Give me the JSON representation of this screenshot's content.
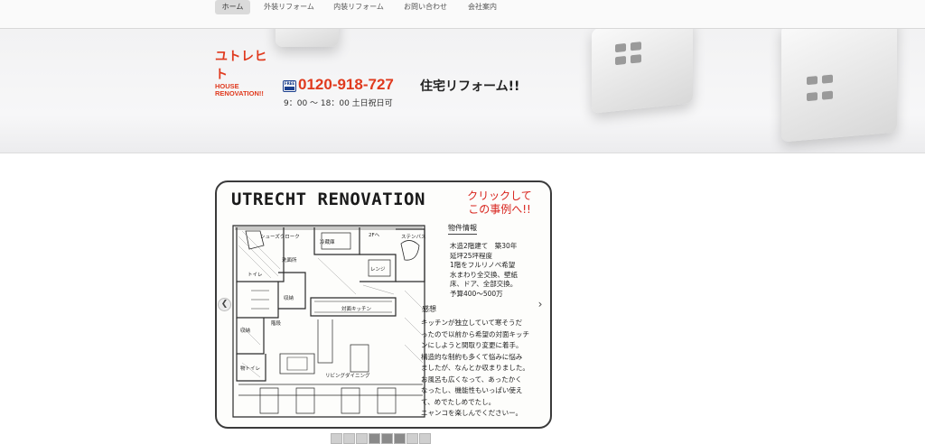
{
  "nav": {
    "items": [
      {
        "label": "ホーム",
        "active": true
      },
      {
        "label": "外装リフォーム",
        "active": false
      },
      {
        "label": "内装リフォーム",
        "active": false
      },
      {
        "label": "お問い合わせ",
        "active": false
      },
      {
        "label": "会社案内",
        "active": false
      }
    ]
  },
  "header": {
    "brand_name": "ユトレヒト",
    "brand_sub_1": "HOUSE",
    "brand_sub_2": "RENOVATION!!",
    "freedial_icon": "free-dial-icon",
    "freedial_text": "FREE",
    "phone": "0120-918-727",
    "hours": "9：00 〜 18：00 土日祝日可",
    "tagline": "住宅リフォーム!!",
    "accent_color": "#e03a1e",
    "freedial_color": "#1b3f8e"
  },
  "slider": {
    "title": "UTRECHT RENOVATION",
    "click_note_1": "クリックして",
    "click_note_2": "この事例へ!!",
    "room_labels": [
      "シューズクローク",
      "洗面所",
      "トイレ",
      "収納",
      "2Fへ",
      "冷蔵庫",
      "レンジ",
      "ステンバス",
      "対面キッチン",
      "収納",
      "階段",
      "物トイレ",
      "リビングダイニング"
    ],
    "info_heading": "物件情報",
    "info_lines": [
      "木造2階建て　築30年",
      "延坪25坪程度",
      "1階をフルリノベ希望",
      "水まわり全交換、壁紙",
      "床、ドア、全部交換。",
      "予算400〜500万"
    ],
    "impressions_heading": "感想",
    "impressions_lines": [
      "キッチンが独立していて寒そうだ",
      "ったので以前から希望の対面キッチ",
      "ンにしようと間取り変更に着手。",
      "構造的な制約も多くて悩みに悩み",
      "ましたが、なんとか収まりました。",
      "お風呂も広くなって、あったかく",
      "なったし、機能性もいっぱい使え",
      "て、めでたしめでたし。",
      "ニャンコを楽しんでくださいー。"
    ],
    "prev_icon": "chevron-left-icon",
    "next_icon": "chevron-right-icon",
    "thumbnail_count": 8
  }
}
